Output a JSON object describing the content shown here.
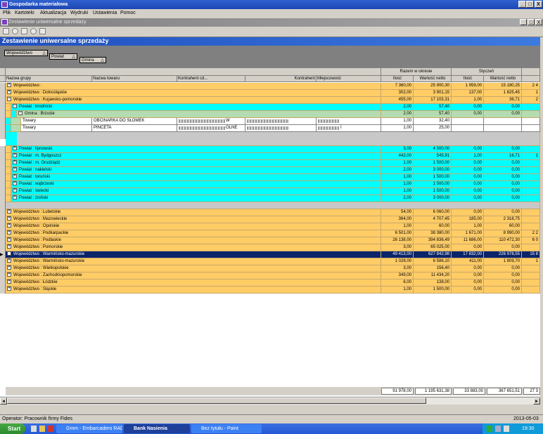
{
  "app": {
    "title": "Gospodarka materiałowa"
  },
  "menu": [
    "Plik",
    "Kartoteki",
    "Aktualizacja",
    "Wydruki",
    "Ustawienia",
    "Pomoc"
  ],
  "window": {
    "min": "_",
    "max": "□",
    "close": "X"
  },
  "child_window": {
    "title": "Zestawienie uniwersalne sprzedaży",
    "min": "_",
    "max": "□",
    "close": "X"
  },
  "report": {
    "title": "Zestawienie uniwersalne sprzedaży"
  },
  "grouping": {
    "level1": "Województwo",
    "level2": "Powiat",
    "level3": "Gmina",
    "sort_glyph": "△"
  },
  "columns": {
    "group_top": {
      "razem": "Razem w okresie",
      "styczen": "Styczeń"
    },
    "headers": [
      "Nazwa grupy",
      "Nazwa towaru",
      "Kontrahent cd...",
      "Kontrahent",
      "Miejscowość",
      "Ilość",
      "Wartość netto",
      "Ilość",
      "Wartość netto"
    ]
  },
  "rows": [
    {
      "type": "woj",
      "label": "Województwo :",
      "q": "7 360,00",
      "v": "25 900,30",
      "q1": "1 959,00",
      "v1": "15 180,25",
      "extra": "2 4"
    },
    {
      "type": "woj",
      "label": "Województwo : Dolnośląskie",
      "q": "302,00",
      "v": "3 901,15",
      "q1": "137,00",
      "v1": "1 825,45",
      "extra": "1"
    },
    {
      "type": "woj-open",
      "label": "Województwo : Kujawsko-pomorskie",
      "q": "455,00",
      "v": "17 103,31",
      "q1": "1,00",
      "v1": "36,71",
      "extra": "2"
    },
    {
      "type": "pow-open",
      "label": "Powiat : brodnicki",
      "q": "2,00",
      "v": "57,40",
      "q1": "0,00",
      "v1": "0,00"
    },
    {
      "type": "gmina",
      "label": "Gmina : Brzozie",
      "q": "2,00",
      "v": "57,40",
      "q1": "0,00",
      "v1": "0,00"
    },
    {
      "type": "item",
      "group": "Towary",
      "name": "OBCINARKA DO SŁOMEK",
      "kontrahent_tail": "W",
      "miejsc_tail": "",
      "q": "1,00",
      "v": "32,40"
    },
    {
      "type": "item",
      "group": "Towary",
      "name": "PINCETA",
      "kontrahent_tail": "OLNE",
      "miejsc_tail": "I",
      "q": "1,00",
      "v": "25,00"
    },
    {
      "type": "gap"
    },
    {
      "type": "pow",
      "label": "Powiat : lipnowski",
      "q": "3,00",
      "v": "4 500,00",
      "q1": "0,00",
      "v1": "0,00"
    },
    {
      "type": "pow",
      "label": "Powiat : m. Bydgoszcz",
      "q": "442,00",
      "v": "545,91",
      "q1": "1,00",
      "v1": "16,71",
      "extra": "1"
    },
    {
      "type": "pow",
      "label": "Powiat : m. Grudziądz",
      "q": "1,00",
      "v": "1 500,00",
      "q1": "0,00",
      "v1": "0,00"
    },
    {
      "type": "pow",
      "label": "Powiat : nakielski",
      "q": "2,00",
      "v": "3 000,00",
      "q1": "0,00",
      "v1": "0,00"
    },
    {
      "type": "pow",
      "label": "Powiat : toruński",
      "q": "1,00",
      "v": "1 500,00",
      "q1": "0,00",
      "v1": "0,00"
    },
    {
      "type": "pow",
      "label": "Powiat : wąbrzeski",
      "q": "1,00",
      "v": "1 500,00",
      "q1": "0,00",
      "v1": "0,00"
    },
    {
      "type": "pow",
      "label": "Powiat : świecki",
      "q": "1,00",
      "v": "1 500,00",
      "q1": "0,00",
      "v1": "0,00"
    },
    {
      "type": "pow",
      "label": "Powiat : żniński",
      "q": "2,00",
      "v": "3 000,00",
      "q1": "0,00",
      "v1": "0,00"
    },
    {
      "type": "gap2"
    },
    {
      "type": "woj",
      "label": "Województwo : Lubelskie",
      "q": "54,00",
      "v": "6 060,00",
      "q1": "0,00",
      "v1": "0,00"
    },
    {
      "type": "woj",
      "label": "Województwo : Mazowieckie",
      "q": "364,00",
      "v": "4 707,45",
      "q1": "185,00",
      "v1": "2 318,75"
    },
    {
      "type": "woj",
      "label": "Województwo : Opolskie",
      "q": "1,00",
      "v": "60,00",
      "q1": "1,00",
      "v1": "60,00"
    },
    {
      "type": "woj",
      "label": "Województwo : Podkarpackie",
      "q": "6 501,00",
      "v": "38 380,00",
      "q1": "1 671,00",
      "v1": "8 990,00",
      "extra": "2 2"
    },
    {
      "type": "woj",
      "label": "Województwo : Podlaskie",
      "q": "26 138,00",
      "v": "394 836,49",
      "q1": "11 686,00",
      "v1": "110 472,30",
      "extra": "6 0"
    },
    {
      "type": "woj",
      "label": "Województwo : Pomorskie",
      "q": "3,00",
      "v": "65 025,00",
      "q1": "0,00",
      "v1": "0,00"
    },
    {
      "type": "woj-sel",
      "label": "Województwo : Warmińsko-mazurskie",
      "q": "49 413,00",
      "v": "627 842,98",
      "q1": "17 832,00",
      "v1": "226 978,55",
      "extra": "15 8"
    },
    {
      "type": "woj",
      "label": "Województwo : Warmińsko-mazurskie",
      "q": "1 028,00",
      "v": "6 586,10",
      "q1": "411,00",
      "v1": "1 809,70",
      "extra": "1"
    },
    {
      "type": "woj",
      "label": "Województwo : Wielkopolskie",
      "q": "3,00",
      "v": "156,40",
      "q1": "0,00",
      "v1": "0,00"
    },
    {
      "type": "woj",
      "label": "Województwo : Zachodniopomorskie",
      "q": "349,00",
      "v": "11 434,20",
      "q1": "0,00",
      "v1": "0,00"
    },
    {
      "type": "woj",
      "label": "Województwo : Łódzkie",
      "q": "6,00",
      "v": "138,00",
      "q1": "0,00",
      "v1": "0,00"
    },
    {
      "type": "woj",
      "label": "Województwo : Śląskie",
      "q": "1,00",
      "v": "1 500,00",
      "q1": "0,00",
      "v1": "0,00"
    }
  ],
  "totals": {
    "q": "91 978,00",
    "v": "1 195 631,38",
    "q1": "33 883,00",
    "v1": "367 651,51",
    "extra": "27 3"
  },
  "status": {
    "operator": "Operator: Pracownik firmy Fides",
    "date": "2013-05-03"
  },
  "taskbar": {
    "start": "Start",
    "tasks": [
      "Gmm - Embarcadero RAD...",
      "Bank Nasienia",
      "Bez tytułu - Paint"
    ],
    "time": "19:30"
  }
}
